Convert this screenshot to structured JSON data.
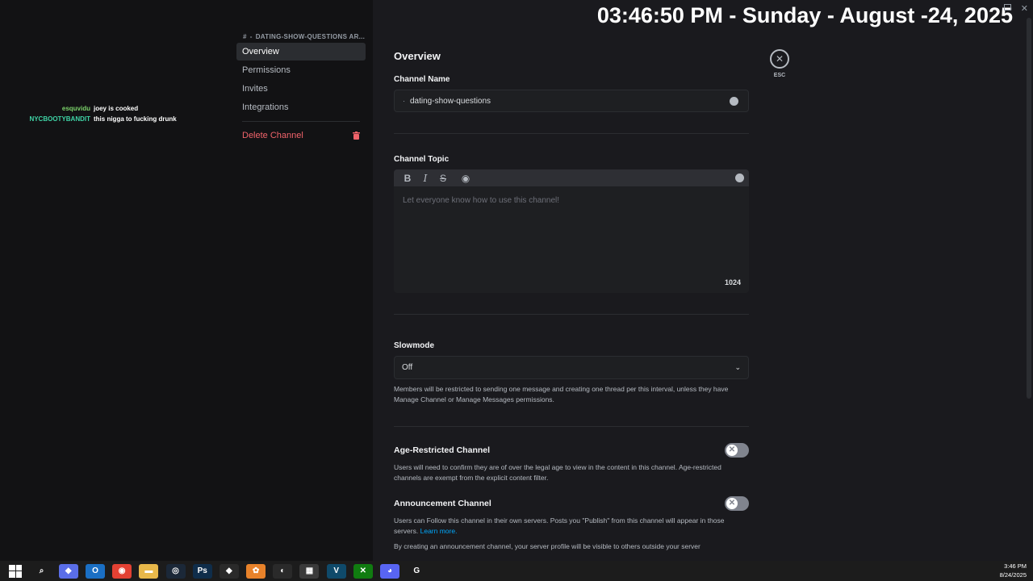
{
  "clock_overlay": "03:46:50 PM - Sunday - August -24, 2025",
  "chat_overlay": [
    {
      "user": "esquvidu",
      "text": "joey is cooked"
    },
    {
      "user": "NYCBOOTYBANDIT",
      "text": "this nigga to fucking drunk"
    }
  ],
  "sidebar": {
    "header": "DATING-SHOW-QUESTIONS AR...",
    "items": [
      "Overview",
      "Permissions",
      "Invites",
      "Integrations"
    ],
    "delete_label": "Delete Channel"
  },
  "main": {
    "title": "Overview",
    "channel_name_label": "Channel Name",
    "channel_name_value": "dating-show-questions",
    "channel_topic_label": "Channel Topic",
    "topic_toolbar": [
      "B",
      "I",
      "S",
      "◉"
    ],
    "topic_placeholder": "Let everyone know how to use this channel!",
    "topic_counter": "1024",
    "slowmode_label": "Slowmode",
    "slowmode_value": "Off",
    "slowmode_help": "Members will be restricted to sending one message and creating one thread per this interval, unless they have Manage Channel or Manage Messages permissions.",
    "age_restricted_label": "Age-Restricted Channel",
    "age_restricted_help": "Users will need to confirm they are of over the legal age to view in the content in this channel. Age-restricted channels are exempt from the explicit content filter.",
    "announcement_label": "Announcement Channel",
    "announcement_help": "Users can Follow this channel in their own servers. Posts you \"Publish\" from this channel will appear in those servers.",
    "learn_more": "Learn more.",
    "announcement_note": "By creating an announcement channel, your server profile will be visible to others outside your server"
  },
  "esc": {
    "icon": "✕",
    "label": "ESC"
  },
  "taskbar": {
    "time": "3:46 PM",
    "date": "8/24/2025",
    "apps": [
      {
        "name": "search-icon",
        "glyph": "⌕",
        "color": "#1c1c1c"
      },
      {
        "name": "copilot-icon",
        "glyph": "◆",
        "color": "#5a6ee8"
      },
      {
        "name": "outlook-icon",
        "glyph": "O",
        "color": "#1a6fc4"
      },
      {
        "name": "chrome-icon",
        "glyph": "◉",
        "color": "#e34133"
      },
      {
        "name": "file-explorer-icon",
        "glyph": "▬",
        "color": "#e8b84a"
      },
      {
        "name": "steam-icon",
        "glyph": "◎",
        "color": "#1b2838"
      },
      {
        "name": "photoshop-icon",
        "glyph": "Ps",
        "color": "#0f2d4a"
      },
      {
        "name": "razer-icon",
        "glyph": "◆",
        "color": "#2a2a2a"
      },
      {
        "name": "fl-studio-icon",
        "glyph": "✿",
        "color": "#e8822a"
      },
      {
        "name": "obs-icon",
        "glyph": "◐",
        "color": "#2a2a2a"
      },
      {
        "name": "store-icon",
        "glyph": "▦",
        "color": "#3a3a3a"
      },
      {
        "name": "v-app-icon",
        "glyph": "V",
        "color": "#0f4a6a"
      },
      {
        "name": "xbox-icon",
        "glyph": "✕",
        "color": "#107c10"
      },
      {
        "name": "discord-icon",
        "glyph": "◕",
        "color": "#5865f2"
      },
      {
        "name": "g-app-icon",
        "glyph": "G",
        "color": "#1c1c1c"
      }
    ]
  }
}
